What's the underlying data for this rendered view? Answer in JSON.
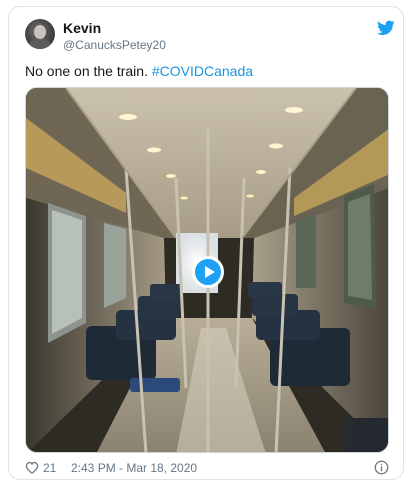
{
  "tweet": {
    "author": {
      "name": "Kevin",
      "handle": "@CanucksPetey20",
      "avatar_icon": "avatar-icon"
    },
    "text": "No one on the train.",
    "hashtag": "#COVIDCanada",
    "media": {
      "type": "video",
      "play_icon": "play-icon"
    },
    "likes": "21",
    "timestamp": "2:43 PM - Mar 18, 2020"
  },
  "icons": {
    "brand": "twitter-bird-icon",
    "like": "heart-icon",
    "info": "info-icon"
  },
  "colors": {
    "accent": "#1da1f2",
    "hashtag": "#1b95e0",
    "muted": "#657786",
    "border": "#dfe3e6"
  }
}
